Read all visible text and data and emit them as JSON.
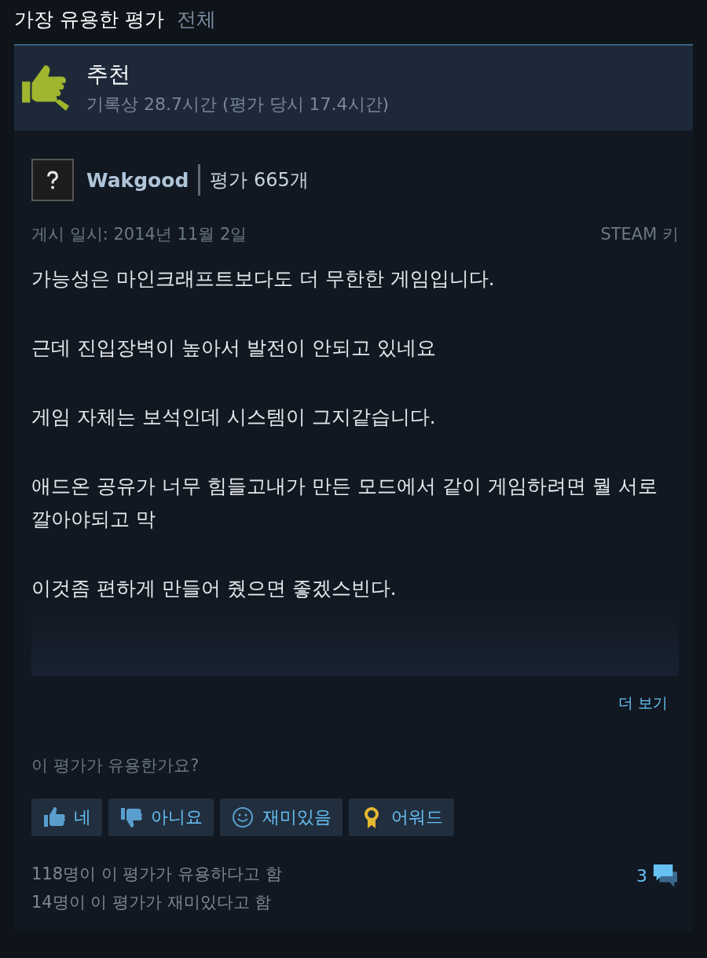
{
  "section": {
    "title": "가장 유용한 평가",
    "link": "전체"
  },
  "verdict": {
    "kind": "recommended",
    "label": "추천",
    "hours": "기록상 28.7시간 (평가 당시 17.4시간)"
  },
  "author": {
    "name": "Wakgood",
    "review_count": "평가 665개"
  },
  "posted": "게시 일시: 2014년 11월 2일",
  "source": "STEAM 키",
  "paragraphs": [
    "가능성은 마인크래프트보다도 더 무한한 게임입니다.",
    "근데 진입장벽이 높아서 발전이 안되고 있네요",
    "게임 자체는 보석인데 시스템이 그지같습니다.",
    "애드온 공유가 너무 힘들고내가 만든 모드에서 같이 게임하려면 뭘 서로 깔아야되고 막",
    "이것좀 편하게 만들어 줬으면 좋겠스빈다."
  ],
  "read_more": "더 보기",
  "question": "이 평가가 유용한가요?",
  "vote_buttons": [
    {
      "kind": "yes",
      "label": "네"
    },
    {
      "kind": "no",
      "label": "아니요"
    },
    {
      "kind": "funny",
      "label": "재미있음"
    },
    {
      "kind": "award",
      "label": "어워드"
    }
  ],
  "stats": [
    "118명이 이 평가가 유용하다고 함",
    "14명이 이 평가가 재미있다고 함"
  ],
  "comment_count": "3"
}
